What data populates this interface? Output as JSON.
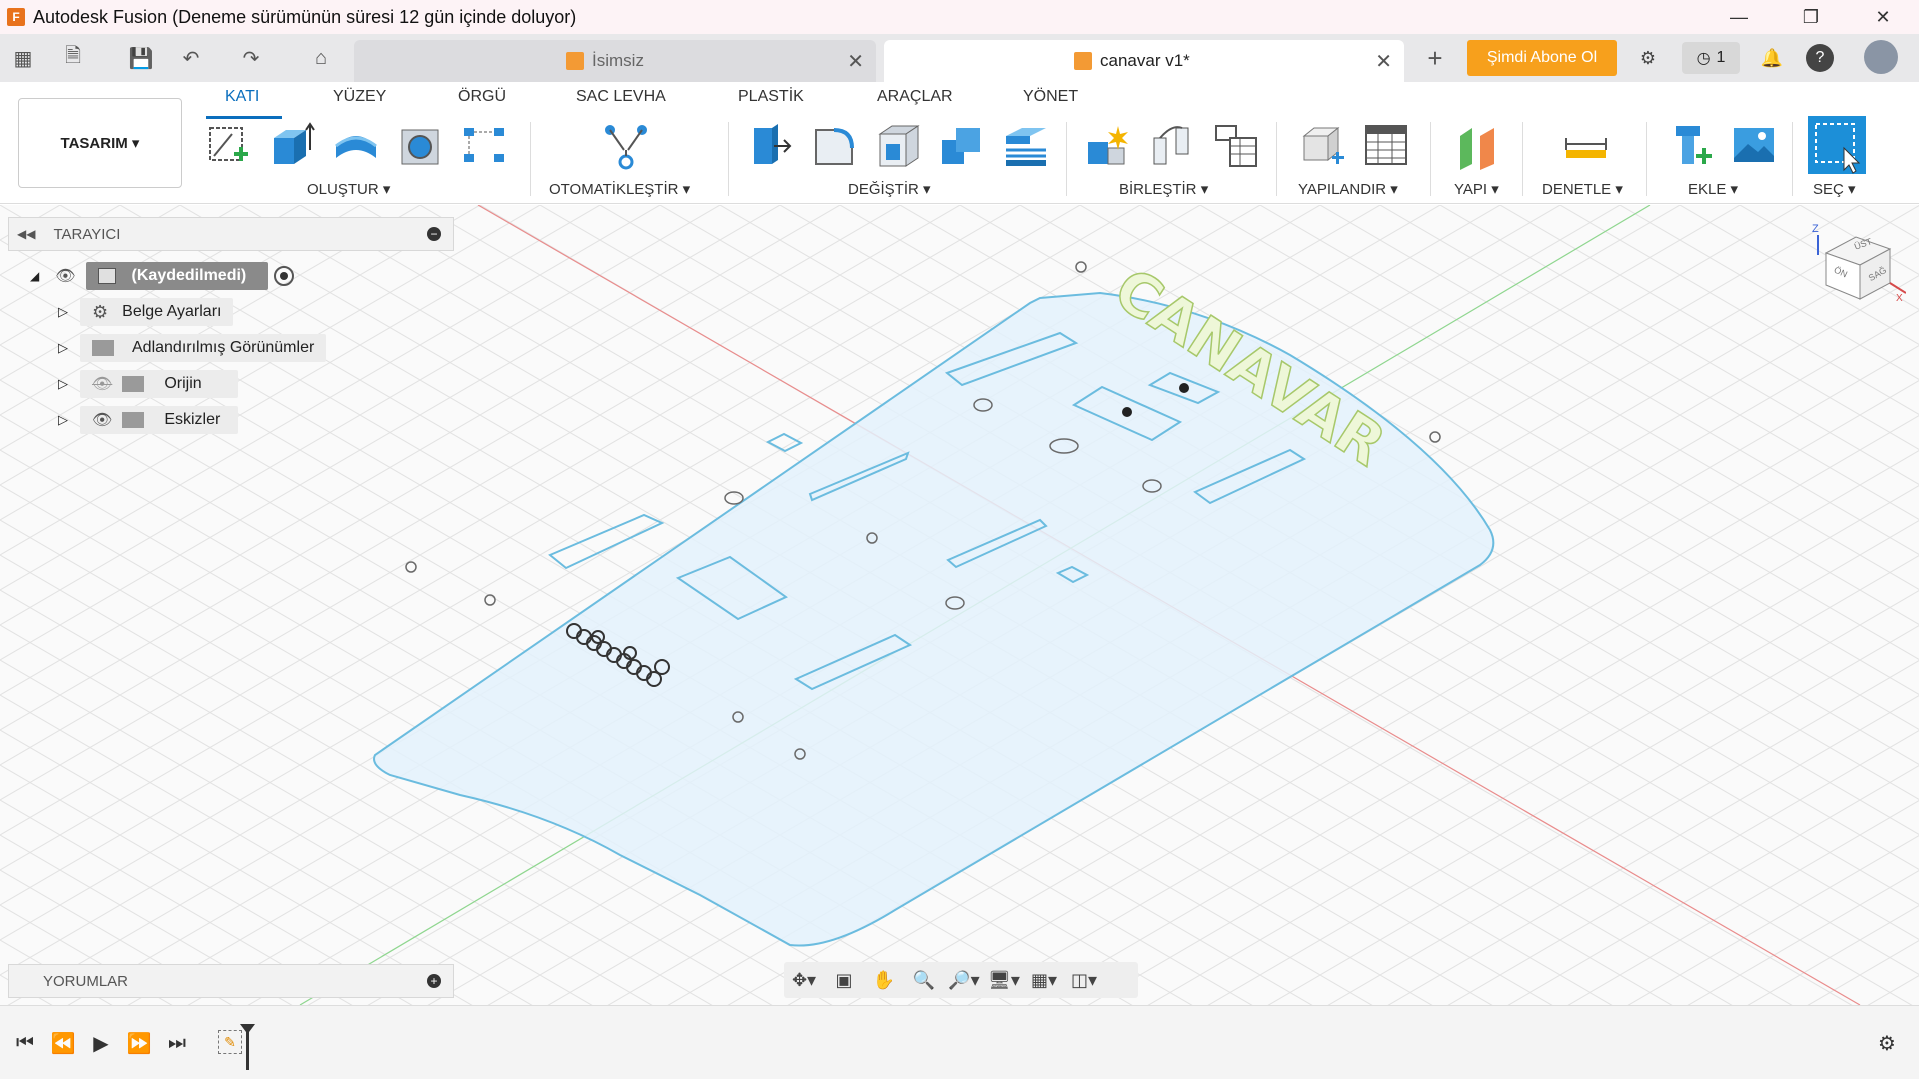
{
  "window": {
    "title": "Autodesk Fusion (Deneme sürümünün süresi 12 gün içinde doluyor)",
    "app_icon_letter": "F"
  },
  "tabs": [
    {
      "label": "İsimsiz",
      "active": false
    },
    {
      "label": "canavar v1*",
      "active": true
    }
  ],
  "header_actions": {
    "subscribe_label": "Şimdi Abone Ol",
    "jobs_count": "1"
  },
  "ribbon": {
    "workspace_label": "TASARIM",
    "tabs": [
      "KATI",
      "YÜZEY",
      "ÖRGÜ",
      "SAC LEVHA",
      "PLASTİK",
      "ARAÇLAR",
      "YÖNET"
    ],
    "active_tab": "KATI",
    "groups": [
      "OLUŞTUR",
      "OTOMATİKLEŞTİR",
      "DEĞİŞTİR",
      "BİRLEŞTİR",
      "YAPILANDIR",
      "YAPI",
      "DENETLE",
      "EKLE",
      "SEÇ"
    ]
  },
  "browser": {
    "title": "TARAYICI",
    "root_label": "(Kaydedilmedi)",
    "items": [
      {
        "label": "Belge Ayarları",
        "icon": "gear-icon"
      },
      {
        "label": "Adlandırılmış Görünümler",
        "icon": "folder-icon"
      },
      {
        "label": "Orijin",
        "icon": "folder-icon",
        "visible": false
      },
      {
        "label": "Eskizler",
        "icon": "folder-icon",
        "visible": true
      }
    ]
  },
  "viewcube": {
    "top": "ÜST",
    "front": "ÖN",
    "right": "SAĞ",
    "axis_x": "X",
    "axis_z": "Z"
  },
  "model": {
    "engraved_text": "CANAVAR"
  },
  "comments": {
    "title": "YORUMLAR"
  },
  "colors": {
    "accent": "#0a6ebd",
    "subscribe": "#f7a01c",
    "plate_fill": "#e3f1fb",
    "plate_stroke": "#6bbcdf"
  }
}
